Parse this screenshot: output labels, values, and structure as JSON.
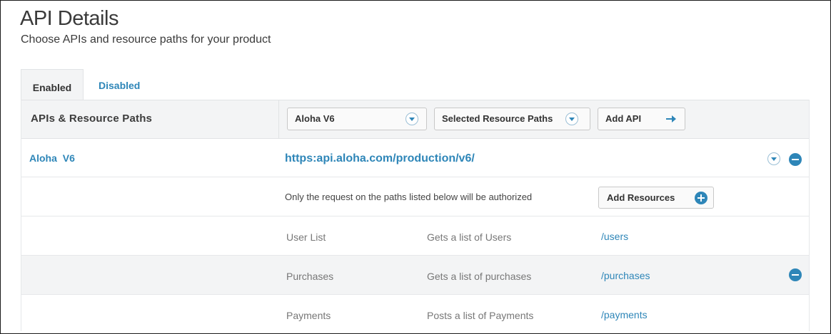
{
  "header": {
    "title": "API Details",
    "subtitle": "Choose APIs and resource paths for your product"
  },
  "tabs": [
    {
      "label": "Enabled",
      "active": true
    },
    {
      "label": "Disabled",
      "active": false
    }
  ],
  "table": {
    "header_label": "APIs & Resource Paths",
    "api_select_value": "Aloha V6",
    "paths_select_value": "Selected Resource Paths",
    "add_api_label": "Add API"
  },
  "api": {
    "name": "Aloha  V6",
    "url": "https:api.aloha.com/production/v6/",
    "note": "Only the request on the paths listed below will be authorized",
    "add_resources_label": "Add Resources"
  },
  "resources": [
    {
      "name": "User List",
      "description": "Gets a list of Users",
      "path": "/users"
    },
    {
      "name": "Purchases",
      "description": "Gets a list of purchases",
      "path": "/purchases"
    },
    {
      "name": "Payments",
      "description": "Posts a list of Payments",
      "path": "/payments"
    }
  ],
  "colors": {
    "accent": "#2e86b8",
    "header_bg": "#f3f4f5"
  }
}
